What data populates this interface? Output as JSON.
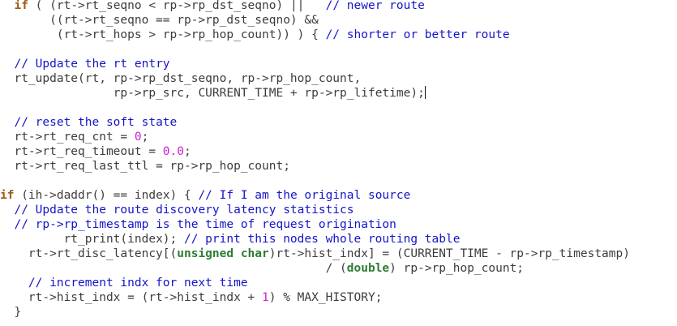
{
  "editor": {
    "lines": [
      {
        "indent": "  ",
        "tokens": [
          {
            "t": "if",
            "k": "kw"
          },
          {
            "t": " ( (rt->rt_seqno < rp->rp_dst_seqno) ||   ",
            "k": "plain"
          },
          {
            "t": "// newer route",
            "k": "cm"
          }
        ]
      },
      {
        "indent": "       ",
        "tokens": [
          {
            "t": "((rt->rt_seqno == rp->rp_dst_seqno) &&",
            "k": "plain"
          }
        ]
      },
      {
        "indent": "        ",
        "tokens": [
          {
            "t": "(rt->rt_hops > rp->rp_hop_count)) ) { ",
            "k": "plain"
          },
          {
            "t": "// shorter or better route",
            "k": "cm"
          }
        ]
      },
      {
        "indent": "",
        "tokens": []
      },
      {
        "indent": "  ",
        "tokens": [
          {
            "t": "// Update the rt entry",
            "k": "cm"
          }
        ]
      },
      {
        "indent": "  ",
        "tokens": [
          {
            "t": "rt_update(rt, rp->rp_dst_seqno, rp->rp_hop_count,",
            "k": "plain"
          }
        ]
      },
      {
        "indent": "                ",
        "tokens": [
          {
            "t": "rp->rp_src, CURRENT_TIME + rp->rp_lifetime);",
            "k": "plain"
          }
        ],
        "cursor": true
      },
      {
        "indent": "",
        "tokens": []
      },
      {
        "indent": "  ",
        "tokens": [
          {
            "t": "// reset the soft state",
            "k": "cm"
          }
        ]
      },
      {
        "indent": "  ",
        "tokens": [
          {
            "t": "rt->rt_req_cnt = ",
            "k": "plain"
          },
          {
            "t": "0",
            "k": "num"
          },
          {
            "t": ";",
            "k": "plain"
          }
        ]
      },
      {
        "indent": "  ",
        "tokens": [
          {
            "t": "rt->rt_req_timeout = ",
            "k": "plain"
          },
          {
            "t": "0.0",
            "k": "num"
          },
          {
            "t": ";",
            "k": "plain"
          }
        ]
      },
      {
        "indent": "  ",
        "tokens": [
          {
            "t": "rt->rt_req_last_ttl = rp->rp_hop_count;",
            "k": "plain"
          }
        ]
      },
      {
        "indent": "",
        "tokens": []
      },
      {
        "indent": "",
        "tokens": [
          {
            "t": "if",
            "k": "kw"
          },
          {
            "t": " (ih->daddr() == index) { ",
            "k": "plain"
          },
          {
            "t": "// If I am the original source",
            "k": "cm"
          }
        ]
      },
      {
        "indent": "  ",
        "tokens": [
          {
            "t": "// Update the route discovery latency statistics",
            "k": "cm"
          }
        ]
      },
      {
        "indent": "  ",
        "tokens": [
          {
            "t": "// rp->rp_timestamp is the time of request origination",
            "k": "cm"
          }
        ]
      },
      {
        "indent": "         ",
        "tokens": [
          {
            "t": "rt_print(index); ",
            "k": "plain"
          },
          {
            "t": "// print this nodes whole routing table",
            "k": "cm"
          }
        ]
      },
      {
        "indent": "    ",
        "tokens": [
          {
            "t": "rt->rt_disc_latency[(",
            "k": "plain"
          },
          {
            "t": "unsigned char",
            "k": "type"
          },
          {
            "t": ")rt->hist_indx] = (CURRENT_TIME - rp->rp_timestamp)",
            "k": "plain"
          }
        ]
      },
      {
        "indent": "                                              ",
        "tokens": [
          {
            "t": "/ (",
            "k": "plain"
          },
          {
            "t": "double",
            "k": "type"
          },
          {
            "t": ") rp->rp_hop_count;",
            "k": "plain"
          }
        ]
      },
      {
        "indent": "    ",
        "tokens": [
          {
            "t": "// increment indx for next time",
            "k": "cm"
          }
        ]
      },
      {
        "indent": "    ",
        "tokens": [
          {
            "t": "rt->hist_indx = (rt->hist_indx + ",
            "k": "plain"
          },
          {
            "t": "1",
            "k": "num"
          },
          {
            "t": ") % MAX_HISTORY;",
            "k": "plain"
          }
        ]
      },
      {
        "indent": "  ",
        "tokens": [
          {
            "t": "}",
            "k": "plain"
          }
        ]
      }
    ]
  },
  "syntax_colors": {
    "plain": "#3c3c3c",
    "kw": "#a05a14",
    "type": "#2e7d32",
    "num": "#d31bd3",
    "cm": "#1414c8",
    "background": "#ffffff"
  }
}
